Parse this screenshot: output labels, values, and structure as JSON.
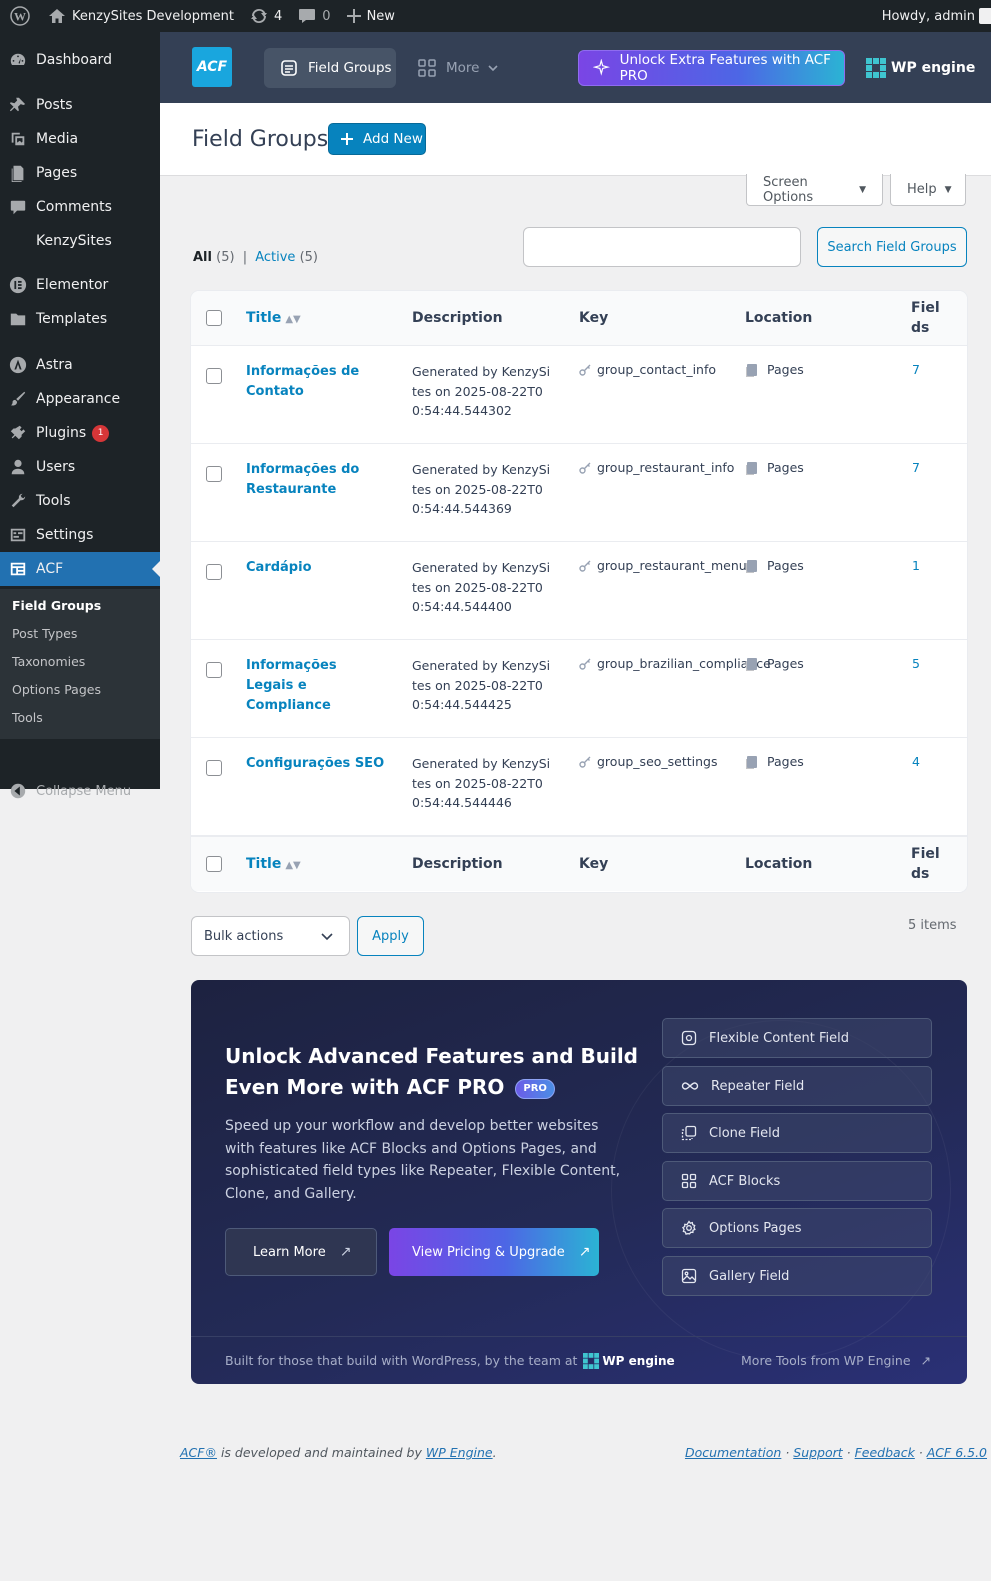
{
  "adminbar": {
    "site_name": "KenzySites Development",
    "updates_count": "4",
    "comments_count": "0",
    "new_label": "New",
    "howdy": "Howdy, admin"
  },
  "sidebar": {
    "items": [
      {
        "label": "Dashboard",
        "icon": "dashboard-icon"
      },
      {
        "label": "Posts",
        "icon": "pin-icon"
      },
      {
        "label": "Media",
        "icon": "media-icon"
      },
      {
        "label": "Pages",
        "icon": "pages-icon"
      },
      {
        "label": "Comments",
        "icon": "comments-icon"
      },
      {
        "label": "KenzySites",
        "icon": ""
      },
      {
        "label": "Elementor",
        "icon": "elementor-icon"
      },
      {
        "label": "Templates",
        "icon": "folder-icon"
      },
      {
        "label": "Astra",
        "icon": "astra-icon"
      },
      {
        "label": "Appearance",
        "icon": "brush-icon"
      },
      {
        "label": "Plugins",
        "icon": "plugin-icon",
        "badge": "1"
      },
      {
        "label": "Users",
        "icon": "users-icon"
      },
      {
        "label": "Tools",
        "icon": "wrench-icon"
      },
      {
        "label": "Settings",
        "icon": "settings-icon"
      },
      {
        "label": "ACF",
        "icon": "acf-icon",
        "active": true
      }
    ],
    "submenu": [
      "Field Groups",
      "Post Types",
      "Taxonomies",
      "Options Pages",
      "Tools"
    ],
    "collapse_label": "Collapse Menu"
  },
  "acf_header": {
    "logo_text": "ACF",
    "tab_field_groups": "Field Groups",
    "tab_more": "More",
    "pro_button": "Unlock Extra Features with ACF PRO",
    "wpengine_text": "WP engine"
  },
  "page": {
    "title": "Field Groups",
    "add_new": "Add New",
    "screen_options": "Screen Options",
    "help": "Help"
  },
  "filters": {
    "all_label": "All",
    "all_count": "(5)",
    "separator": "|",
    "active_label": "Active",
    "active_count": "(5)"
  },
  "search": {
    "placeholder": "",
    "button": "Search Field Groups"
  },
  "table": {
    "columns": {
      "title": "Title",
      "description": "Description",
      "key": "Key",
      "location": "Location",
      "fields": "Fiel ds"
    },
    "rows": [
      {
        "title": "Informações de Contato",
        "description": "Generated by KenzySites on 2025-08-22T00:54:44.544302",
        "key": "group_contact_info",
        "location": "Pages",
        "fields": "7"
      },
      {
        "title": "Informações do Restaurante",
        "description": "Generated by KenzySites on 2025-08-22T00:54:44.544369",
        "key": "group_restaurant_info",
        "location": "Pages",
        "fields": "7"
      },
      {
        "title": "Cardápio",
        "description": "Generated by KenzySites on 2025-08-22T00:54:44.544400",
        "key": "group_restaurant_menu",
        "location": "Pages",
        "fields": "1"
      },
      {
        "title": "Informações Legais e Compliance",
        "description": "Generated by KenzySites on 2025-08-22T00:54:44.544425",
        "key": "group_brazilian_compliance",
        "location": "Pages",
        "fields": "5"
      },
      {
        "title": "Configurações SEO",
        "description": "Generated by KenzySites on 2025-08-22T00:54:44.544446",
        "key": "group_seo_settings",
        "location": "Pages",
        "fields": "4"
      }
    ]
  },
  "bulk": {
    "selected": "Bulk actions",
    "apply": "Apply",
    "items_count": "5 items"
  },
  "promo": {
    "title": "Unlock Advanced Features and Build Even More with ACF PRO",
    "badge": "PRO",
    "description": "Speed up your workflow and develop better websites with features like ACF Blocks and Options Pages, and sophisticated field types like Repeater, Flexible Content, Clone, and Gallery.",
    "learn_more": "Learn More",
    "view_pricing": "View Pricing & Upgrade",
    "features": [
      {
        "label": "Flexible Content Field",
        "icon": "flexible-content-icon"
      },
      {
        "label": "Repeater Field",
        "icon": "infinity-icon"
      },
      {
        "label": "Clone Field",
        "icon": "clone-icon"
      },
      {
        "label": "ACF Blocks",
        "icon": "blocks-icon"
      },
      {
        "label": "Options Pages",
        "icon": "gear-icon"
      },
      {
        "label": "Gallery Field",
        "icon": "image-icon"
      }
    ],
    "footer_text": "Built for those that build with WordPress, by the team at",
    "footer_brand": "WP engine",
    "more_tools": "More Tools from WP Engine"
  },
  "footer": {
    "acf_link": "ACF®",
    "developed_text": " is developed and maintained by ",
    "wpengine_link": "WP Engine",
    "period": ".",
    "links": [
      "Documentation",
      "Support",
      "Feedback",
      "ACF 6.5.0"
    ],
    "separator": " · "
  },
  "colors": {
    "admin_dark": "#1d2327",
    "active_blue": "#2271b1",
    "acf_blue": "#0783be",
    "acf_header": "#344055",
    "badge_red": "#d63638"
  }
}
